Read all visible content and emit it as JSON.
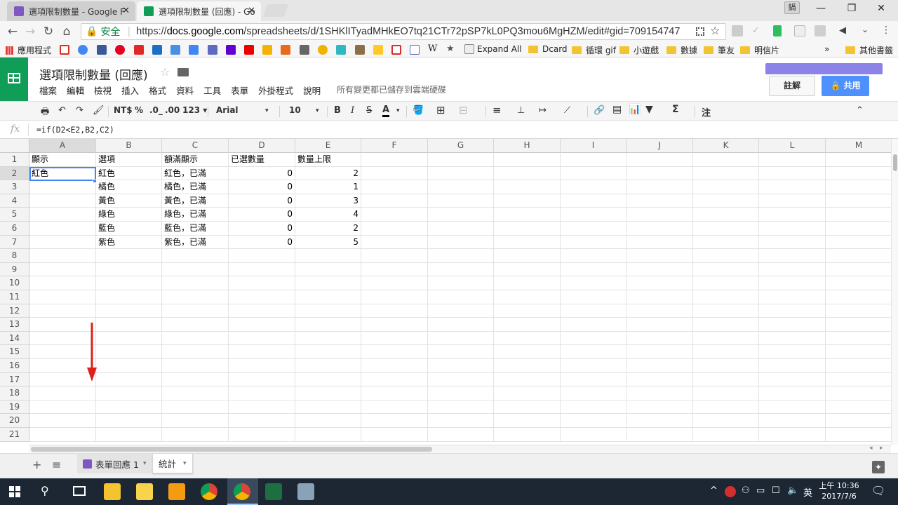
{
  "browser": {
    "tabs": [
      {
        "title": "選項限制數量 - Google F",
        "close": "✕",
        "icon_color": "#7e57c2"
      },
      {
        "title": "選項限制數量 (回應) - Go",
        "close": "✕",
        "icon_color": "#0f9d58"
      }
    ],
    "user_badge": "鍋",
    "window_controls": {
      "minimize": "—",
      "restore": "❐",
      "close": "✕"
    },
    "nav": {
      "back": "←",
      "forward": "→",
      "reload": "↻",
      "home": "⌂"
    },
    "security_label": "安全",
    "url_prefix": "https://",
    "url_host": "docs.google.com",
    "url_path": "/spreadsheets/d/1SHKlITyadMHkEO7tq21CTr72pSP7kL0PQ3mou6MgHZM/edit#gid=709154747",
    "bookmarks": [
      {
        "label": "應用程式",
        "color": "#e53935"
      },
      {
        "label": "Expand All",
        "color": "#555"
      },
      {
        "label": "Dcard",
        "folder": true
      },
      {
        "label": "循環 gif",
        "folder": true
      },
      {
        "label": "小遊戲",
        "folder": true
      },
      {
        "label": "數據",
        "folder": true
      },
      {
        "label": "筆友",
        "folder": true
      },
      {
        "label": "明信片",
        "folder": true
      },
      {
        "label": "»"
      },
      {
        "label": "其他書籤",
        "folder": true
      }
    ]
  },
  "sheets": {
    "doc_title": "選項限制數量 (回應)",
    "star": "☆",
    "menus": [
      "檔案",
      "編輯",
      "檢視",
      "插入",
      "格式",
      "資料",
      "工具",
      "表單",
      "外掛程式",
      "說明"
    ],
    "saved_status": "所有變更都已儲存到雲端硬碟",
    "notes_button": "註解",
    "share_button": "🔒 共用",
    "toolbar": {
      "currency": "NT$",
      "percent": "%",
      "dec_less": ".0_",
      "dec_more": ".00",
      "more_formats": "123 ▾",
      "font": "Arial",
      "font_size": "10",
      "bold": "B",
      "italic": "I",
      "strike": "S",
      "text_color": "A",
      "input_tools": "注"
    },
    "formula_icon": "fx",
    "formula": "=if(D2<E2,B2,C2)",
    "columns": [
      "A",
      "B",
      "C",
      "D",
      "E",
      "F",
      "G",
      "H",
      "I",
      "J",
      "K",
      "L",
      "M"
    ],
    "row_numbers": [
      "1",
      "2",
      "3",
      "4",
      "5",
      "6",
      "7",
      "8",
      "9",
      "10",
      "11",
      "12",
      "13",
      "14",
      "15",
      "16",
      "17",
      "18",
      "19",
      "20",
      "21"
    ],
    "headers": [
      "顯示",
      "選項",
      "額滿顯示",
      "已選數量",
      "數量上限"
    ],
    "rows": [
      {
        "a": "紅色",
        "b": "紅色",
        "c": "紅色，已滿",
        "d": "0",
        "e": "2"
      },
      {
        "a": "",
        "b": "橘色",
        "c": "橘色，已滿",
        "d": "0",
        "e": "1"
      },
      {
        "a": "",
        "b": "黃色",
        "c": "黃色，已滿",
        "d": "0",
        "e": "3"
      },
      {
        "a": "",
        "b": "綠色",
        "c": "綠色，已滿",
        "d": "0",
        "e": "4"
      },
      {
        "a": "",
        "b": "藍色",
        "c": "藍色，已滿",
        "d": "0",
        "e": "2"
      },
      {
        "a": "",
        "b": "紫色",
        "c": "紫色，已滿",
        "d": "0",
        "e": "5"
      }
    ],
    "sheet_tabs": [
      {
        "label": "表單回應 1",
        "active": false
      },
      {
        "label": "統計",
        "active": true
      }
    ],
    "add_sheet": "+",
    "all_sheets": "≡"
  },
  "taskbar": {
    "tray_time": "上午 10:36",
    "tray_date": "2017/7/6",
    "ime": "英"
  }
}
